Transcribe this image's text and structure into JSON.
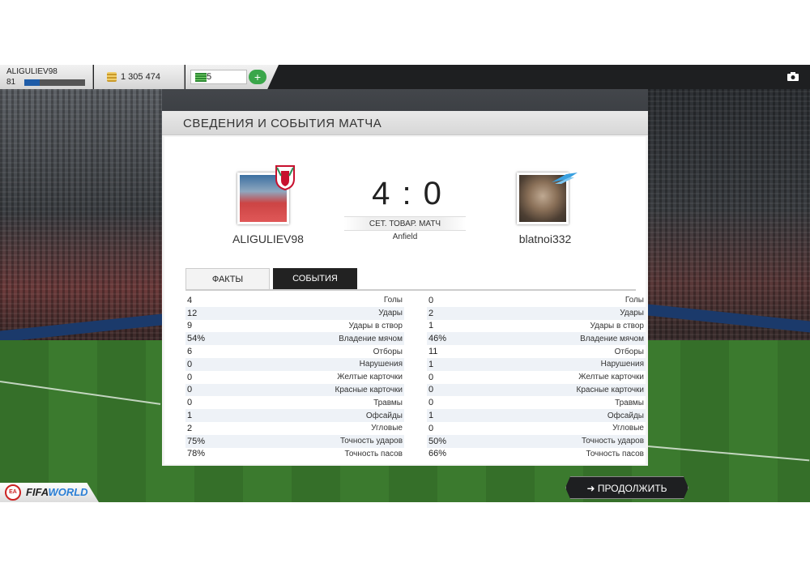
{
  "profile": {
    "name": "ALIGULIEV98",
    "level": "81",
    "xp_progress": 0.25
  },
  "currency": {
    "coins": "1 305 474",
    "points": "5"
  },
  "panel": {
    "title": "СВЕДЕНИЯ И СОБЫТИЯ МАТЧА"
  },
  "match": {
    "score": "4 : 0",
    "type": "СЕТ. ТОВАР. МАТЧ",
    "stadium": "Anfield",
    "home_name": "ALIGULIEV98",
    "away_name": "blatnoi332"
  },
  "tabs": {
    "facts": "ФАКТЫ",
    "events": "СОБЫТИЯ"
  },
  "stats": {
    "labels": [
      "Голы",
      "Удары",
      "Удары в створ",
      "Владение мячом",
      "Отборы",
      "Нарушения",
      "Желтые карточки",
      "Красные карточки",
      "Травмы",
      "Офсайды",
      "Угловые",
      "Точность ударов",
      "Точность пасов"
    ],
    "home": [
      "4",
      "12",
      "9",
      "54%",
      "6",
      "0",
      "0",
      "0",
      "0",
      "1",
      "2",
      "75%",
      "78%"
    ],
    "away": [
      "0",
      "2",
      "1",
      "46%",
      "11",
      "1",
      "0",
      "0",
      "0",
      "1",
      "0",
      "50%",
      "66%"
    ]
  },
  "footer": {
    "continue_label": "ПРОДОЛЖИТЬ",
    "brand_fifa": "FIFA",
    "brand_world": "WORLD",
    "ea": "EA SPORTS"
  },
  "colors": {
    "accent_blue": "#1e5ca8",
    "add_green": "#3aa64a",
    "dark_bar": "#1e1f21"
  }
}
